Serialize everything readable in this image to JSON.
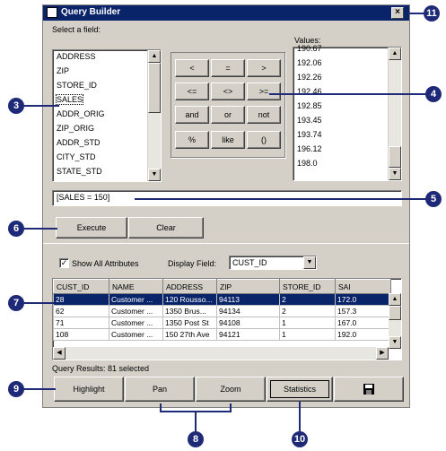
{
  "window": {
    "title": "Query Builder",
    "close_label": "×"
  },
  "fields": {
    "label": "Select a field:",
    "items": [
      "ADDRESS",
      "ZIP",
      "STORE_ID",
      "SALES",
      "ADDR_ORIG",
      "ZIP_ORIG",
      "ADDR_STD",
      "CITY_STD",
      "STATE_STD"
    ]
  },
  "operators": [
    "<",
    "=",
    ">",
    "<=",
    "<>",
    ">=",
    "and",
    "or",
    "not",
    "%",
    "like",
    "()"
  ],
  "values": {
    "label": "Values:",
    "items": [
      "190.67",
      "192.06",
      "192.26",
      "192.46",
      "192.85",
      "193.45",
      "193.74",
      "196.12",
      "198.0"
    ]
  },
  "expression": {
    "value": "[SALES = 150]"
  },
  "buttons": {
    "execute": "Execute",
    "clear": "Clear"
  },
  "options": {
    "show_all_attributes": "Show All Attributes",
    "show_all_checked": true,
    "display_field_label": "Display Field:",
    "display_field_value": "CUST_ID"
  },
  "table": {
    "columns": [
      "CUST_ID",
      "NAME",
      "ADDRESS",
      "ZIP",
      "STORE_ID",
      "SAI"
    ],
    "rows": [
      [
        "28",
        "Customer ...",
        "120 Rousso...",
        "94113",
        "2",
        "172.0"
      ],
      [
        "62",
        "Customer ...",
        "1350 Brus...",
        "94134",
        "2",
        "157.3"
      ],
      [
        "71",
        "Customer ...",
        "1350 Post St",
        "94108",
        "1",
        "167.0"
      ],
      [
        "108",
        "Customer ...",
        "150 27th Ave",
        "94121",
        "1",
        "192.0"
      ]
    ]
  },
  "status": "Query Results: 81 selected",
  "bottom_buttons": {
    "highlight": "Highlight",
    "pan": "Pan",
    "zoom": "Zoom",
    "statistics": "Statistics"
  },
  "callouts": {
    "c3": "3",
    "c4": "4",
    "c5": "5",
    "c6": "6",
    "c7": "7",
    "c8": "8",
    "c9": "9",
    "c10": "10",
    "c11": "11"
  },
  "colors": {
    "callout": "#1e2a78",
    "titlebar": "#0a246a",
    "face": "#d4d0c8"
  }
}
